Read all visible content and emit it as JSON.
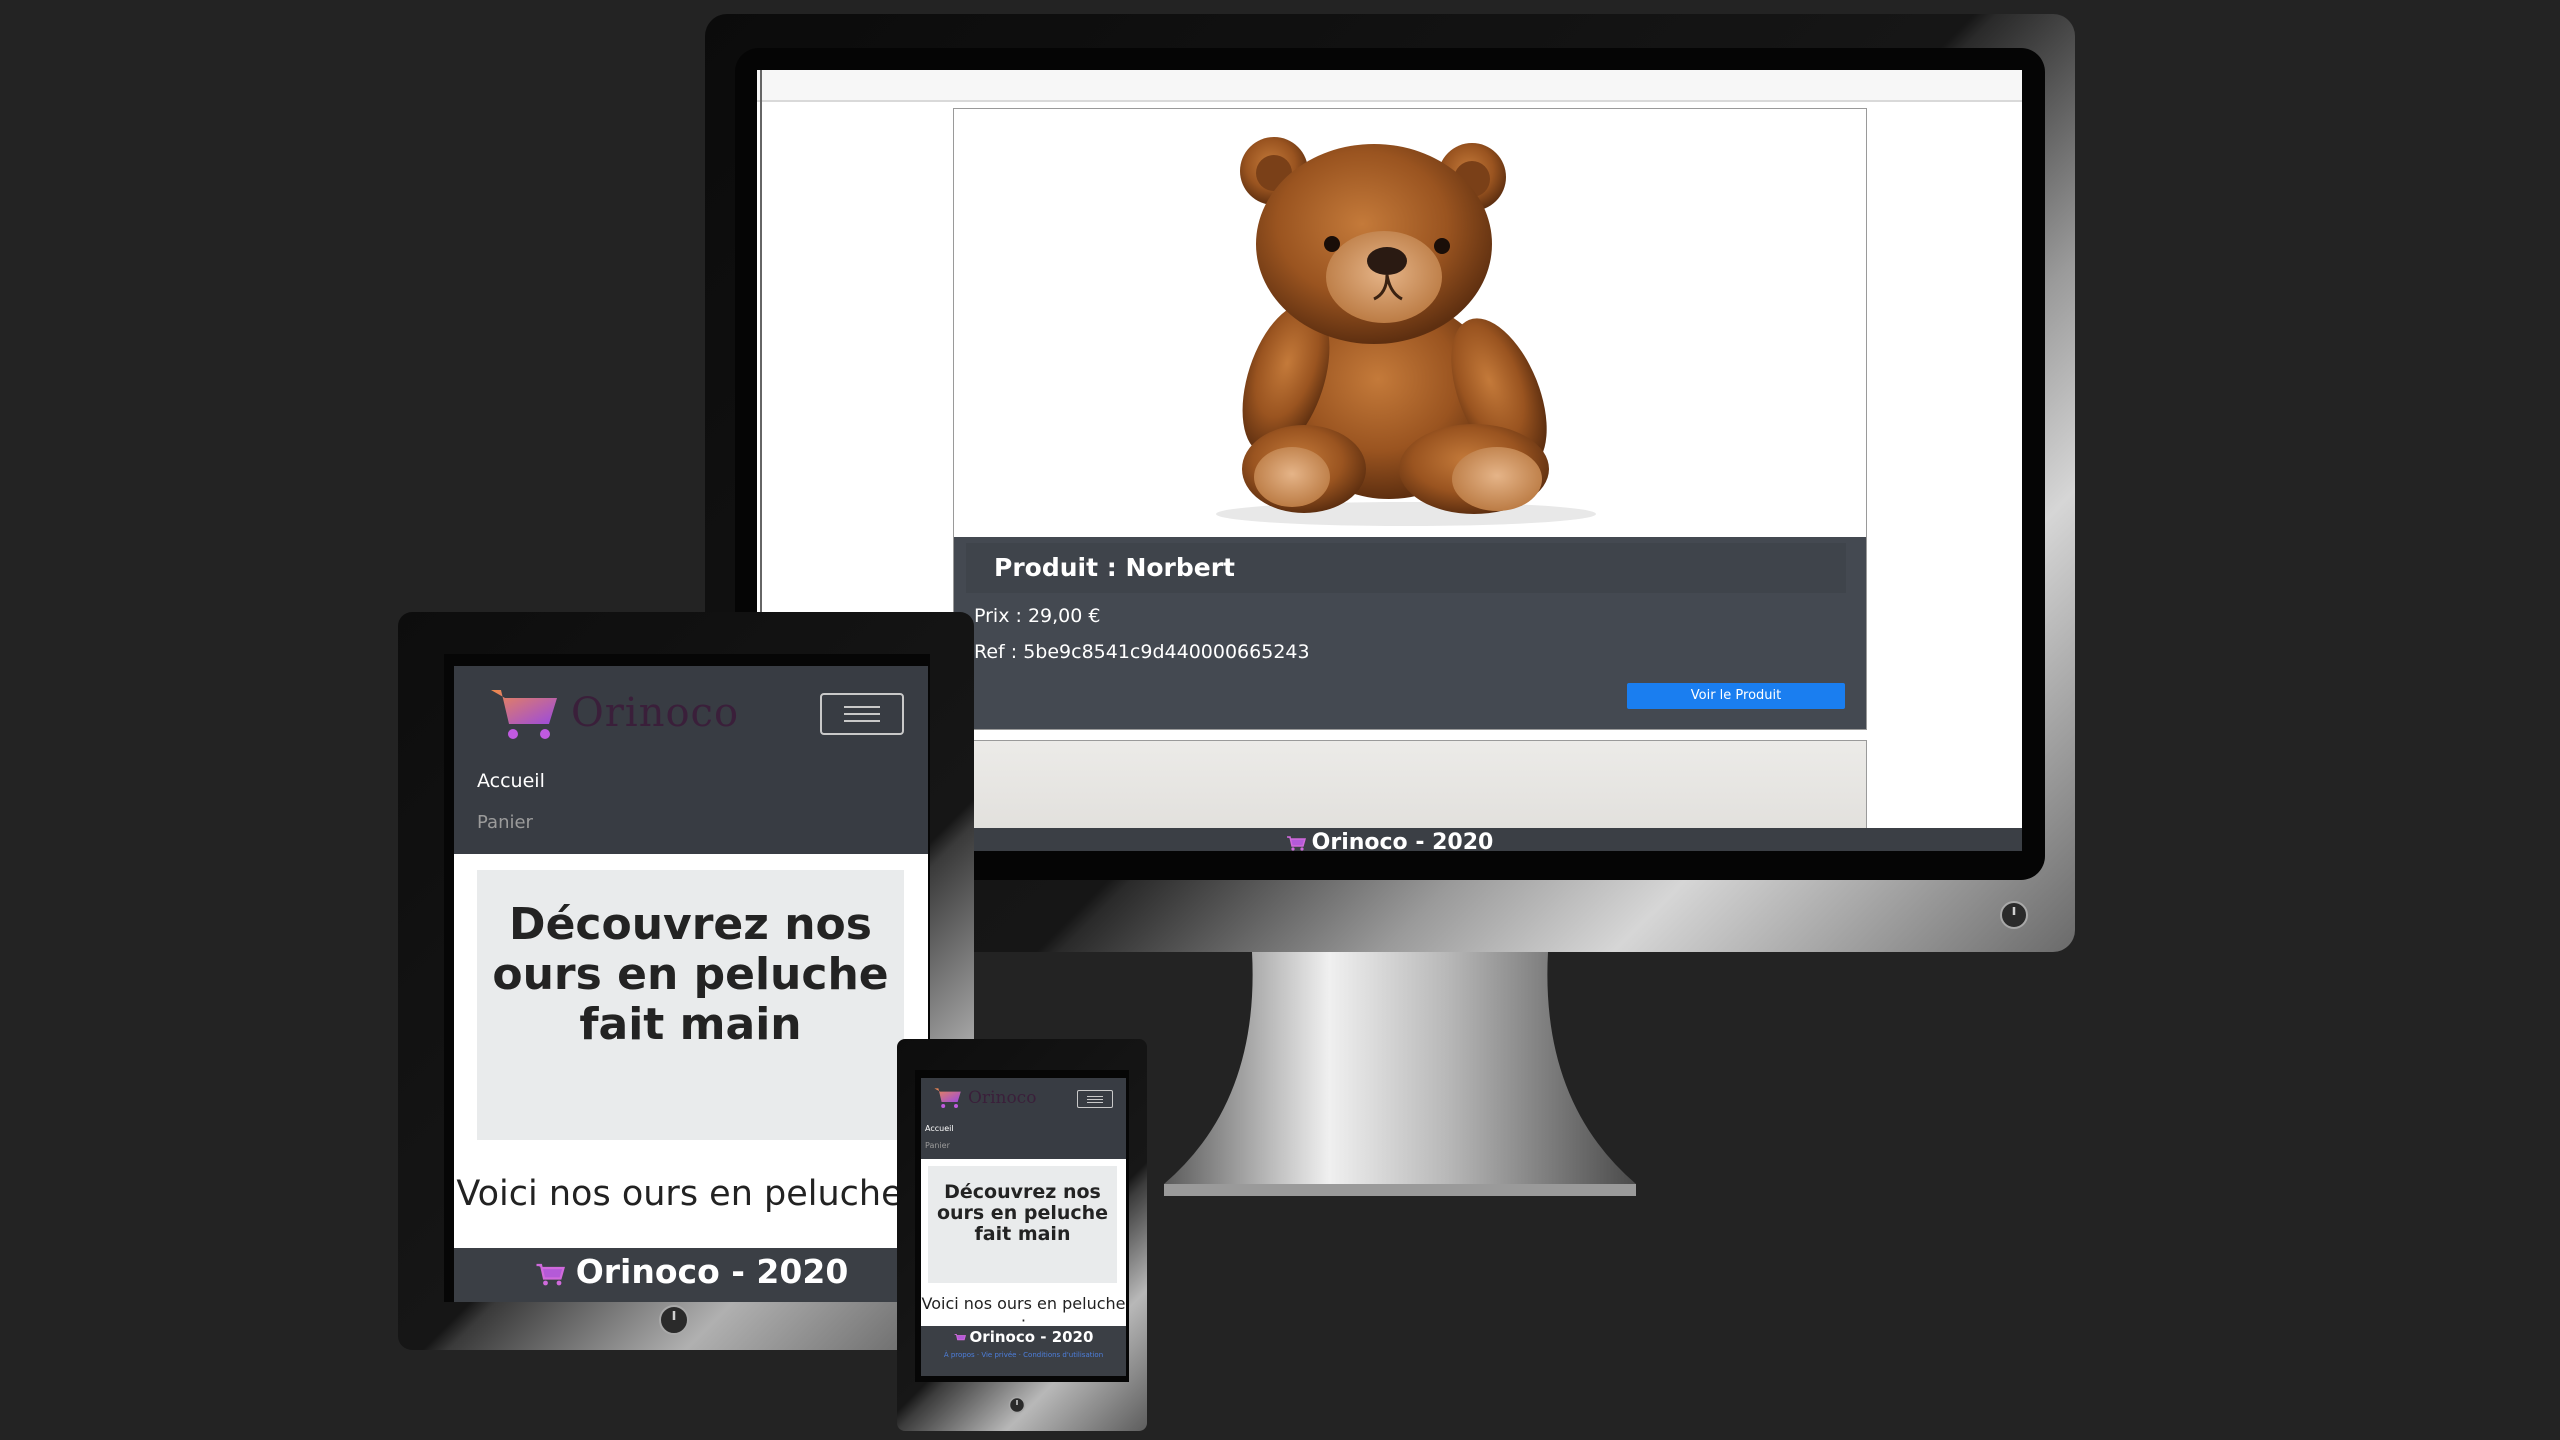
{
  "monitor": {
    "product_title": "Produit : Norbert",
    "price": "Prix : 29,00 €",
    "ref": "Ref : 5be9c8541c9d440000665243",
    "button_label": "Voir le Produit",
    "footer": "Orinoco - 2020"
  },
  "tablet": {
    "logo_text": "Orinoco",
    "nav_items": [
      "Accueil",
      "Panier"
    ],
    "headline": "Découvrez nos ours en peluche fait main",
    "subheading": "Voici nos ours en peluche :",
    "footer": "Orinoco - 2020"
  },
  "phone": {
    "logo_text": "Orinoco",
    "nav_items": [
      "Accueil",
      "Panier"
    ],
    "headline": "Découvrez nos ours en peluche fait main",
    "subheading": "Voici nos ours en peluche :",
    "footer": "Orinoco - 2020",
    "footer_links": "À propos · Vie privée · Conditions d'utilisation"
  },
  "colors": {
    "background": "#232323",
    "navbar": "#383c43",
    "card_body": "#444951",
    "button": "#1a7ef0",
    "jumbotron": "#e9ebec"
  },
  "icons": [
    "cart-logo-icon",
    "hamburger-menu-icon",
    "power-icon"
  ]
}
